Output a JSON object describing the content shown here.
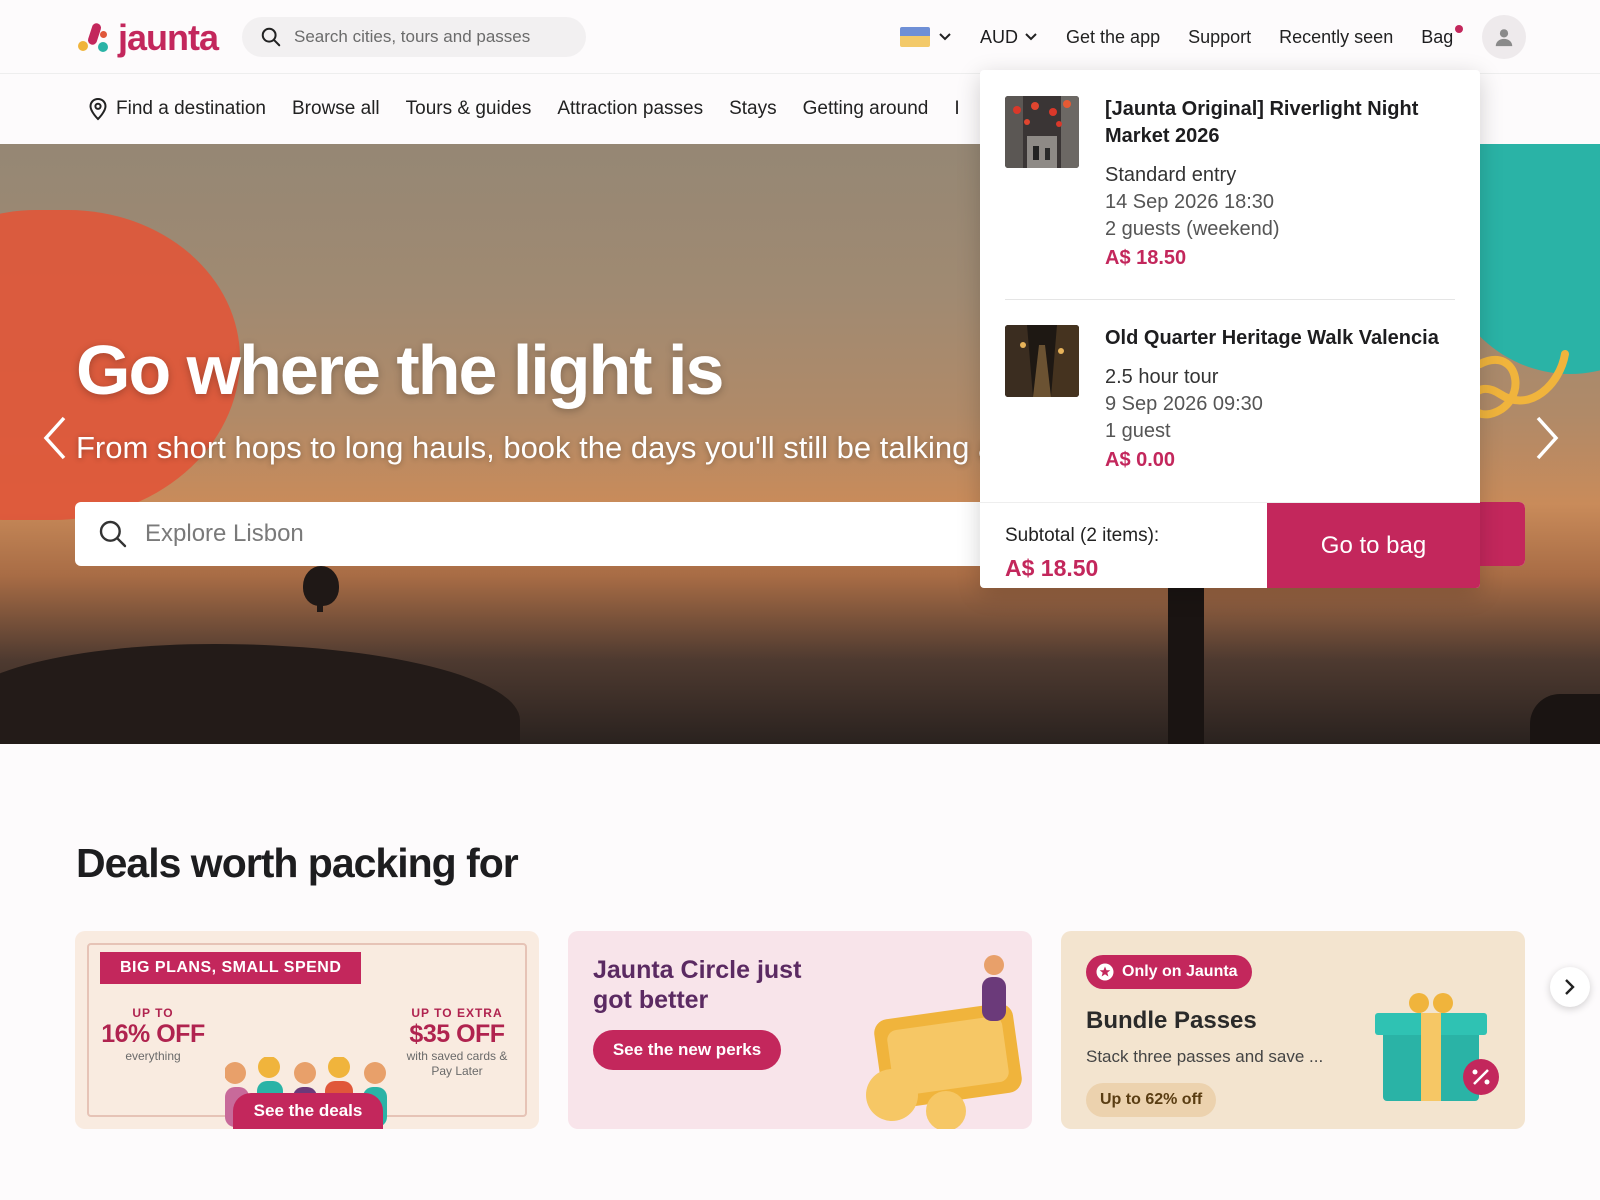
{
  "brand": {
    "name": "jaunta"
  },
  "header": {
    "search_placeholder": "Search cities, tours and passes",
    "currency": "AUD",
    "links": [
      "Get the app",
      "Support",
      "Recently seen"
    ],
    "bag_label": "Bag",
    "bag_has_items": true
  },
  "category_nav": {
    "items": [
      "Find a destination",
      "Browse all",
      "Tours & guides",
      "Attraction passes",
      "Stays",
      "Getting around",
      "I"
    ]
  },
  "hero": {
    "title": "Go where the light is",
    "subtitle": "From short hops to long hauls, book the days you'll still be talking a",
    "search_placeholder": "Explore Lisbon"
  },
  "bag_dropdown": {
    "items": [
      {
        "title": "[Jaunta Original] Riverlight Night Market 2026",
        "option": "Standard entry",
        "date": "14 Sep 2026 18:30",
        "guests": "2 guests (weekend)",
        "price": "A$ 18.50"
      },
      {
        "title": "Old Quarter Heritage Walk Valencia",
        "option": "2.5 hour tour",
        "date": "9 Sep 2026 09:30",
        "guests": "1 guest",
        "price": "A$ 0.00"
      }
    ],
    "subtotal_label": "Subtotal (2 items):",
    "subtotal_value": "A$ 18.50",
    "go_to_bag": "Go to bag"
  },
  "deals": {
    "title": "Deals worth packing for",
    "card1": {
      "tag": "BIG PLANS, SMALL SPEND",
      "left_small": "UP TO",
      "left_big": "16% OFF",
      "left_note": "everything",
      "right_small": "UP TO EXTRA",
      "right_big": "$35 OFF",
      "right_note": "with saved cards & Pay Later",
      "button": "See the deals"
    },
    "card2": {
      "title": "Jaunta Circle just got better",
      "button": "See the new perks"
    },
    "card3": {
      "tag": "Only on Jaunta",
      "title": "Bundle Passes",
      "subtitle": "Stack three passes and save ...",
      "pill": "Up to 62% off"
    }
  },
  "colors": {
    "brand": "#c3275c",
    "hero_orange": "#e0573a",
    "hero_teal": "#2ab3a6"
  }
}
